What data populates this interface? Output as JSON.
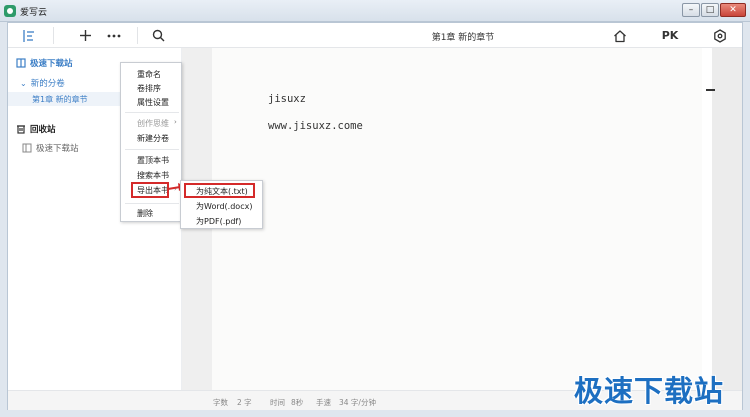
{
  "window": {
    "title": "爱写云"
  },
  "toolbar": {
    "menu_icon": "list-icon",
    "add_icon": "plus-icon",
    "more_icon": "more-icon",
    "search_icon": "search-icon",
    "doc_title": "第1章  新的章节",
    "home_icon": "home-icon",
    "pk_label": "PK",
    "settings_icon": "hexagon-settings-icon"
  },
  "sidebar": {
    "book_name": "极速下载站",
    "volume_name": "新的分卷",
    "chapter_name": "第1章  新的章节",
    "recycle_label": "回收站",
    "recycle_book": "极速下载站"
  },
  "editor": {
    "lines": [
      "jisuxz",
      "www.jisuxz.come"
    ]
  },
  "context_menu": {
    "items": [
      "重命名",
      "卷排序",
      "属性设置",
      "创作思维",
      "新建分卷",
      "置顶本书",
      "搜索本书",
      "导出本书",
      "删除"
    ]
  },
  "export_submenu": {
    "items": [
      "为纯文本(.txt)",
      "为Word(.docx)",
      "为PDF(.pdf)"
    ]
  },
  "status": {
    "chars_label": "字数",
    "chars_value": "2 字",
    "time_label": "时间",
    "time_value": "8秒",
    "speed_label": "手速",
    "speed_value": "34 字/分钟"
  },
  "watermark": "极速下载站",
  "colors": {
    "accent": "#3d7fc6",
    "highlight": "#d42a2a",
    "watermark": "#1d6fc1"
  }
}
